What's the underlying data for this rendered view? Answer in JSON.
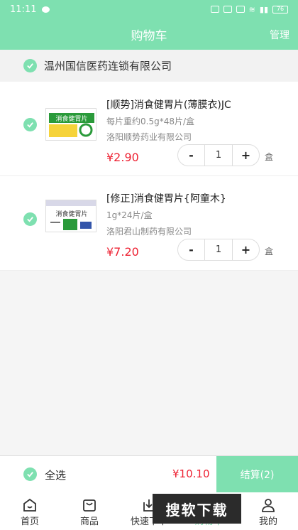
{
  "status": {
    "time": "11:11",
    "battery": "76"
  },
  "nav": {
    "title": "购物车",
    "manage": "管理"
  },
  "store": {
    "name": "温州国信医药连锁有限公司"
  },
  "items": [
    {
      "name": "[顺势]消食健胃片(薄膜衣)JC",
      "spec": "每片重约0.5g*48片/盒",
      "maker": "洛阳顺势药业有限公司",
      "price": "¥2.90",
      "qty": "1",
      "unit": "盒",
      "minus": "-",
      "plus": "+",
      "image_text": "消食健胃片"
    },
    {
      "name": "[修正]消食健胃片{阿童木}",
      "spec": "1g*24片/盒",
      "maker": "洛阳君山制药有限公司",
      "price": "¥7.20",
      "qty": "1",
      "unit": "盒",
      "minus": "-",
      "plus": "+",
      "image_text": "消食健胃片"
    }
  ],
  "checkout": {
    "select_all": "全选",
    "total": "¥10.10",
    "pay": "结算(2)"
  },
  "tabs": [
    {
      "label": "首页",
      "icon": "home-icon"
    },
    {
      "label": "商品",
      "icon": "bag-icon"
    },
    {
      "label": "快速下单",
      "icon": "download-icon"
    },
    {
      "label": "购物车",
      "icon": "cart-icon"
    },
    {
      "label": "我的",
      "icon": "user-icon"
    }
  ],
  "watermark": "搜软下载",
  "colors": {
    "accent": "#7ee0b0",
    "price": "#ee2233"
  }
}
